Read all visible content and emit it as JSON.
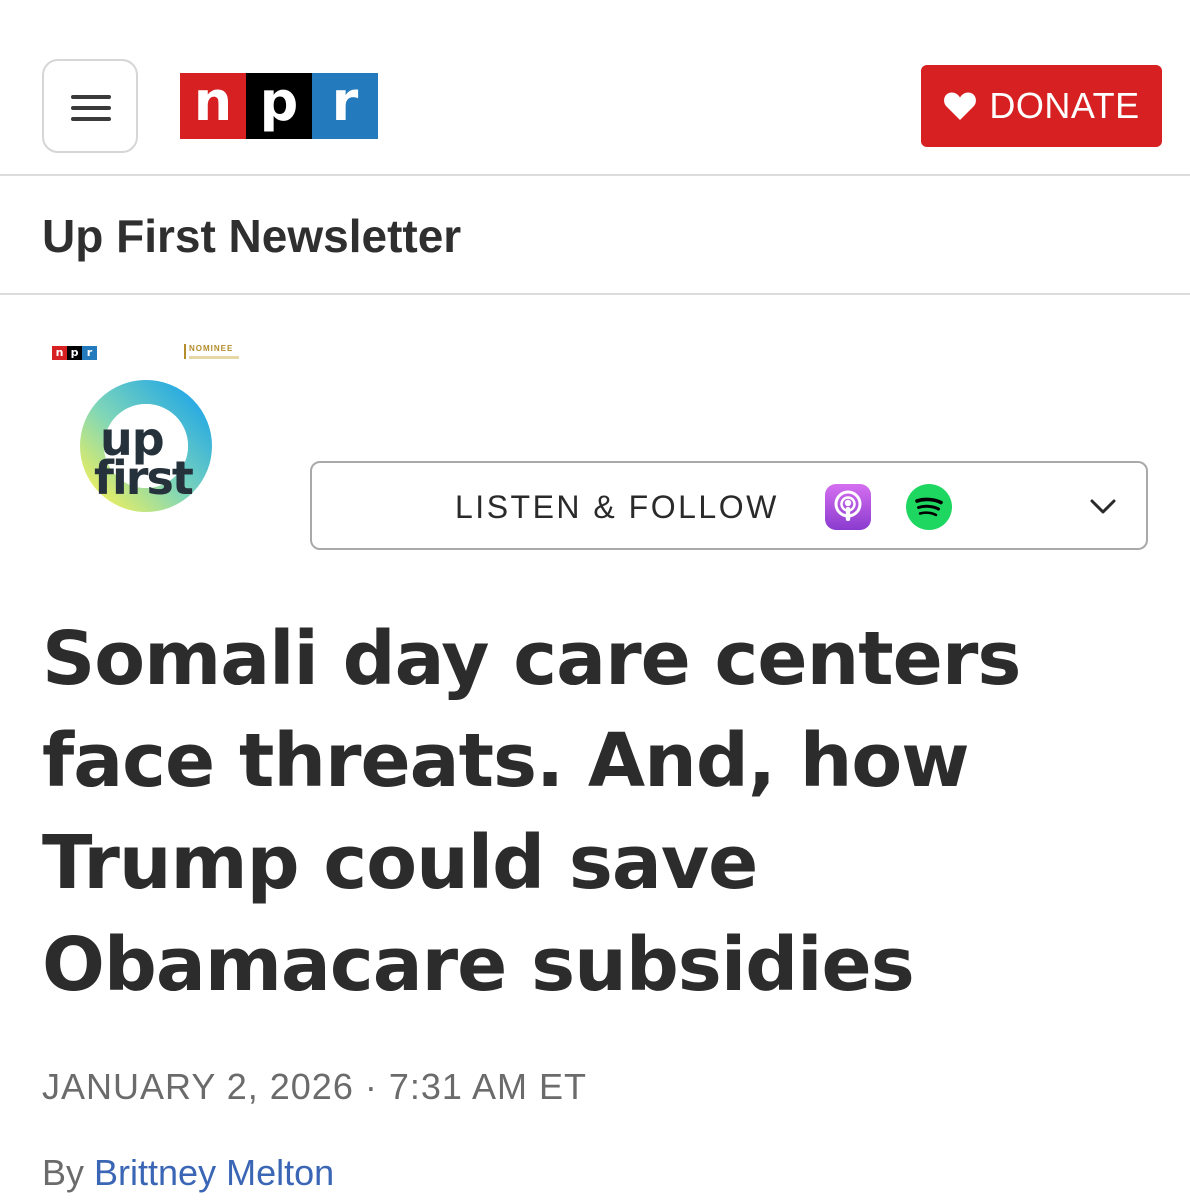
{
  "header": {
    "logo_letters": [
      "n",
      "p",
      "r"
    ],
    "logo_colors": [
      "#d62021",
      "#000000",
      "#237bbd"
    ],
    "menu_icon": "hamburger-icon",
    "donate": {
      "label": "DONATE",
      "icon": "heart-icon",
      "color": "#d62021"
    }
  },
  "section": {
    "title": "Up First Newsletter"
  },
  "podcast": {
    "art_text_line1": "up",
    "art_text_line2": "first",
    "mini_logo": [
      "n",
      "p",
      "r"
    ],
    "badge": "NOMINEE"
  },
  "listen": {
    "label": "LISTEN & FOLLOW",
    "icons": [
      "apple-podcasts-icon",
      "spotify-icon",
      "chevron-down-icon"
    ]
  },
  "article": {
    "headline": "Somali day care centers face threats. And, how Trump could save Obamacare subsidies",
    "date": "JANUARY 2, 2026",
    "separator": "·",
    "time": "7:31 AM ET",
    "byline_prefix": "By",
    "author": "Brittney Melton",
    "author_color": "#3a66b5"
  }
}
